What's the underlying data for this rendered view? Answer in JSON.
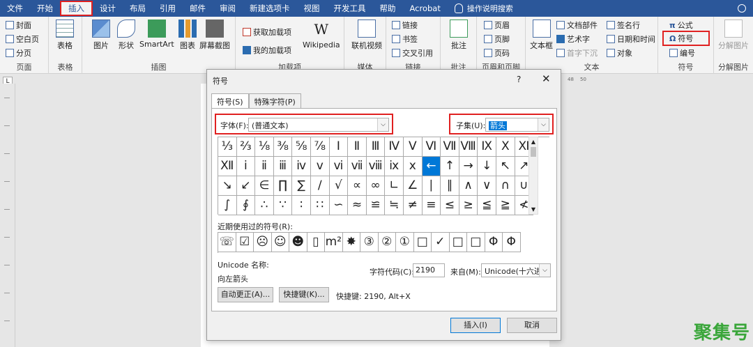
{
  "menubar": {
    "tabs": [
      "文件",
      "开始",
      "插入",
      "设计",
      "布局",
      "引用",
      "邮件",
      "审阅",
      "新建选项卡",
      "视图",
      "开发工具",
      "帮助",
      "Acrobat"
    ],
    "search_label": "操作说明搜索"
  },
  "ribbon": {
    "pages": {
      "label": "页面",
      "cover": "封面",
      "blank": "空白页",
      "break": "分页"
    },
    "tables": {
      "label": "表格",
      "table": "表格"
    },
    "illustrations": {
      "label": "插图",
      "pictures": "图片",
      "shapes": "形状",
      "smartart": "SmartArt",
      "chart": "图表",
      "screenshot": "屏幕截图"
    },
    "addins": {
      "label": "加载项",
      "get": "获取加载项",
      "mine": "我的加载项",
      "wikipedia": "Wikipedia",
      "wiki_glyph": "W"
    },
    "media": {
      "label": "媒体",
      "video": "联机视频"
    },
    "links": {
      "label": "链接",
      "link": "链接",
      "bookmark": "书签",
      "crossref": "交叉引用"
    },
    "comments": {
      "label": "批注",
      "comment": "批注"
    },
    "headerfooter": {
      "label": "页眉和页脚",
      "header": "页眉",
      "footer": "页脚",
      "pagenum": "页码"
    },
    "text": {
      "label": "文本",
      "textbox": "文本框",
      "parts": "文档部件",
      "wordart": "艺术字",
      "dropcap": "首字下沉",
      "signature": "签名行",
      "datetime": "日期和时间",
      "object": "对象"
    },
    "symbols": {
      "label": "符号",
      "equation": "公式",
      "symbol": "符号",
      "number": "编号"
    },
    "split": {
      "label": "分解图片",
      "split": "分解图片"
    }
  },
  "ruler": {
    "m1": "48",
    "m2": "50"
  },
  "dialog": {
    "title": "符号",
    "help": "?",
    "close": "✕",
    "tab_symbols": "符号(S)",
    "tab_special": "特殊字符(P)",
    "font_label": "字体(F):",
    "font_value": "(普通文本)",
    "subset_label": "子集(U):",
    "subset_value": "箭头",
    "symbols": [
      [
        "⅓",
        "⅔",
        "⅛",
        "⅜",
        "⅝",
        "⅞",
        "Ⅰ",
        "Ⅱ",
        "Ⅲ",
        "Ⅳ",
        "Ⅴ",
        "Ⅵ",
        "Ⅶ",
        "Ⅷ",
        "Ⅸ",
        "Ⅹ",
        "Ⅺ"
      ],
      [
        "Ⅻ",
        "ⅰ",
        "ⅱ",
        "ⅲ",
        "ⅳ",
        "ⅴ",
        "ⅵ",
        "ⅶ",
        "ⅷ",
        "ⅸ",
        "ⅹ",
        "←",
        "↑",
        "→",
        "↓",
        "↖",
        "↗"
      ],
      [
        "↘",
        "↙",
        "∈",
        "∏",
        "∑",
        "∕",
        "√",
        "∝",
        "∞",
        "∟",
        "∠",
        "∣",
        "∥",
        "∧",
        "∨",
        "∩",
        "∪"
      ],
      [
        "∫",
        "∮",
        "∴",
        "∵",
        "∶",
        "∷",
        "∽",
        "≈",
        "≌",
        "≒",
        "≠",
        "≡",
        "≤",
        "≥",
        "≦",
        "≧",
        "≮"
      ]
    ],
    "selected": "←",
    "recent_label": "近期使用过的符号(R):",
    "recent": [
      "☏",
      "☑",
      "☹",
      "☺",
      "☻",
      "▯",
      "m²",
      "✸",
      "③",
      "②",
      "①",
      "□",
      "✓",
      "□",
      "□",
      "Φ",
      "Φ"
    ],
    "unicode_name_label": "Unicode 名称:",
    "unicode_name": "向左箭头",
    "charcode_label": "字符代码(C):",
    "charcode": "2190",
    "from_label": "来自(M):",
    "from_value": "Unicode(十六进制)",
    "autocorrect": "自动更正(A)...",
    "shortcut_btn": "快捷键(K)...",
    "shortcut_text": "快捷键: 2190, Alt+X",
    "insert": "插入(I)",
    "cancel": "取消"
  },
  "watermark": "聚集号"
}
